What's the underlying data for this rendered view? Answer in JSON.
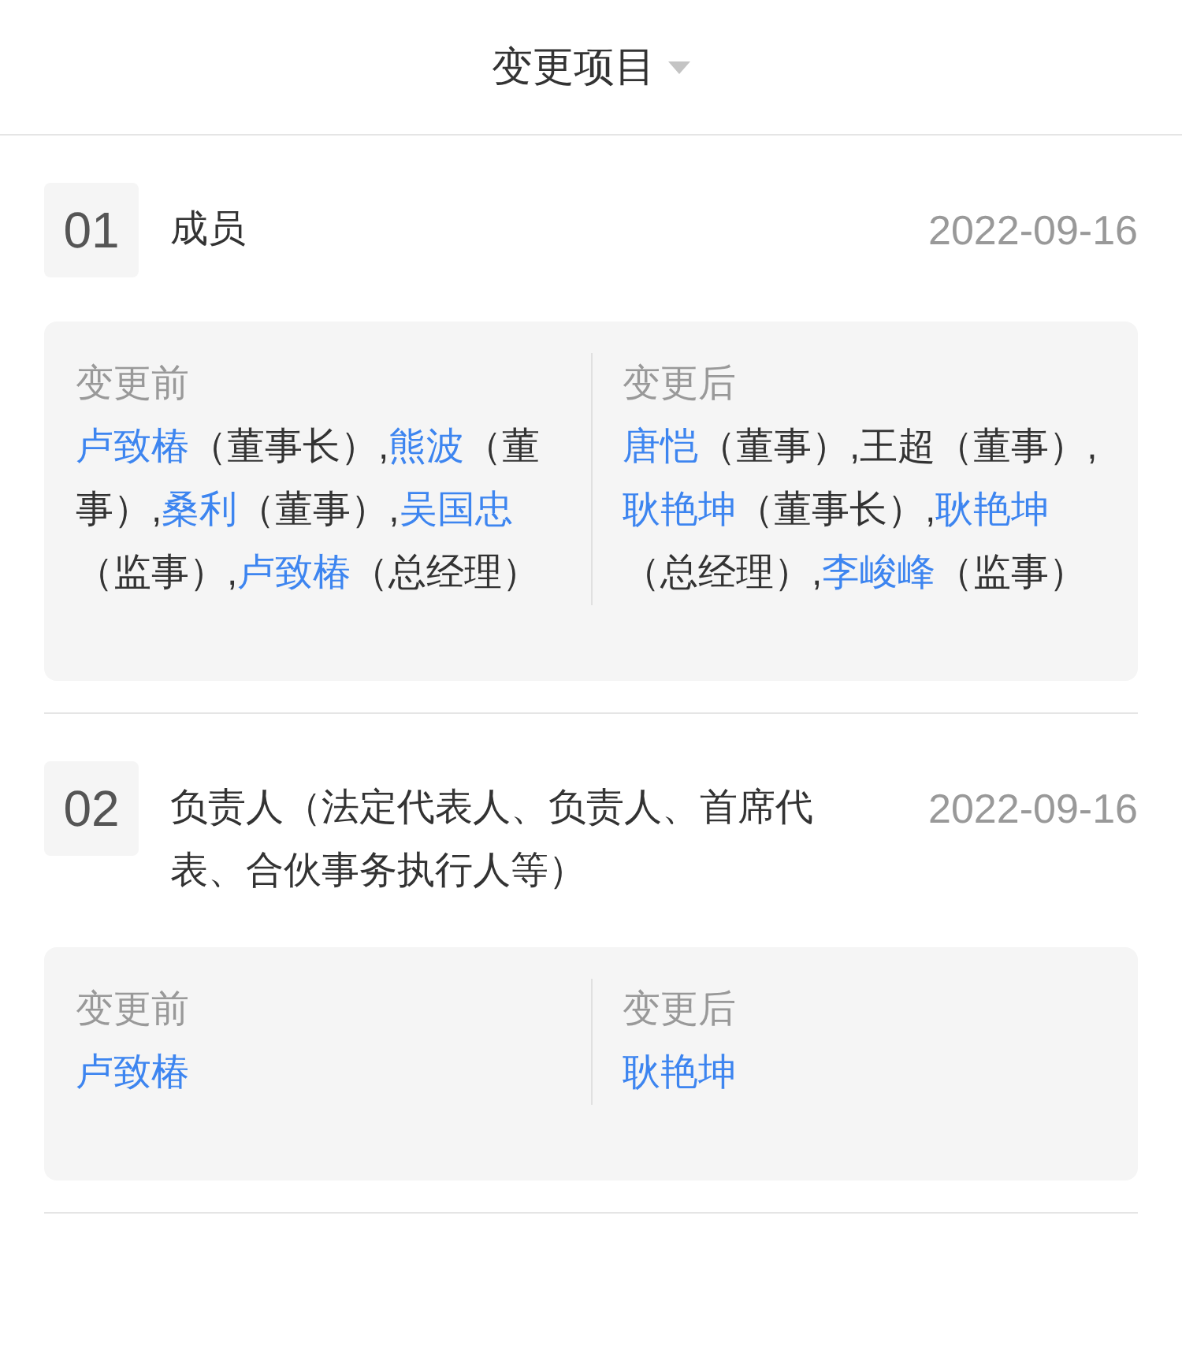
{
  "header": {
    "title": "变更项目"
  },
  "items": [
    {
      "number": "01",
      "title": "成员",
      "date": "2022-09-16",
      "before": {
        "label": "变更前",
        "segments": [
          {
            "kind": "link",
            "text": "卢致椿"
          },
          {
            "kind": "plain",
            "text": "（董事长）,"
          },
          {
            "kind": "link",
            "text": "熊波"
          },
          {
            "kind": "plain",
            "text": "（董事）,"
          },
          {
            "kind": "link",
            "text": "桑利"
          },
          {
            "kind": "plain",
            "text": "（董事）,"
          },
          {
            "kind": "link",
            "text": "吴国忠"
          },
          {
            "kind": "plain",
            "text": "（监事）,"
          },
          {
            "kind": "link",
            "text": "卢致椿"
          },
          {
            "kind": "plain",
            "text": "（总经理）"
          }
        ]
      },
      "after": {
        "label": "变更后",
        "segments": [
          {
            "kind": "link",
            "text": "唐恺"
          },
          {
            "kind": "plain",
            "text": "（董事）,王超（董事）,"
          },
          {
            "kind": "link",
            "text": "耿艳坤"
          },
          {
            "kind": "plain",
            "text": "（董事长）,"
          },
          {
            "kind": "link",
            "text": "耿艳坤"
          },
          {
            "kind": "plain",
            "text": "（总经理）,"
          },
          {
            "kind": "link",
            "text": "李峻峰"
          },
          {
            "kind": "plain",
            "text": "（监事）"
          }
        ]
      }
    },
    {
      "number": "02",
      "title": "负责人（法定代表人、负责人、首席代表、合伙事务执行人等）",
      "date": "2022-09-16",
      "before": {
        "label": "变更前",
        "segments": [
          {
            "kind": "link",
            "text": "卢致椿"
          }
        ]
      },
      "after": {
        "label": "变更后",
        "segments": [
          {
            "kind": "link",
            "text": "耿艳坤"
          }
        ]
      }
    }
  ]
}
